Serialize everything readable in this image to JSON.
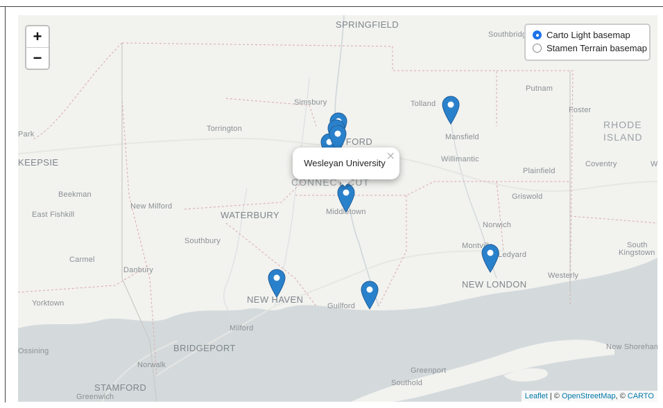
{
  "map": {
    "zoom_in_label": "+",
    "zoom_out_label": "−",
    "layers": [
      {
        "label": "Carto Light basemap",
        "selected": true
      },
      {
        "label": "Stamen Terrain basemap",
        "selected": false
      }
    ],
    "popup": {
      "text": "Wesleyan University",
      "close": "×"
    },
    "markers": [
      "marker-1",
      "marker-2",
      "marker-3",
      "marker-4",
      "marker-5",
      "marker-6",
      "marker-7",
      "marker-8",
      "marker-9"
    ],
    "marker_color": "#2a81cb",
    "water_color": "#d4dadc",
    "land_color": "#f2f2ef",
    "attribution": {
      "leaflet": "Leaflet",
      "separator1": " | © ",
      "osm": "OpenStreetMap",
      "separator2": ", © ",
      "carto": "CARTO"
    },
    "places": {
      "springfield": "SPRINGFIELD",
      "southbridge": "Southbridge",
      "putnam": "Putnam",
      "foster": "Foster",
      "rhode": "RHODE",
      "island": "ISLAND",
      "coventry": "Coventry",
      "w": "W",
      "simsbury": "Simsbury",
      "tolland": "Tolland",
      "mansfield": "Mansfield",
      "torrington": "Torrington",
      "hartford": "HARTFORD",
      "park": "Park",
      "keepsie": "KEEPSIE",
      "willimantic": "Willimantic",
      "plainfield": "Plainfield",
      "connecticut": "CONNECTICUT",
      "beekman": "Beekman",
      "griswold": "Griswold",
      "new_milford": "New Milford",
      "east_fishkill": "East Fishkill",
      "waterbury": "WATERBURY",
      "middletown": "Middletown",
      "norwich": "Norwich",
      "southbury": "Southbury",
      "montville": "Montville",
      "ledyard": "Ledyard",
      "south_kingstown_1": "South",
      "south_kingstown_2": "Kingstown",
      "carmel": "Carmel",
      "danbury": "Danbury",
      "westerly": "Westerly",
      "new_london": "NEW LONDON",
      "yorktown": "Yorktown",
      "new_haven": "NEW HAVEN",
      "guilford": "Guilford",
      "milford": "Milford",
      "bridgeport": "BRIDGEPORT",
      "new_shoreham": "New Shoreham",
      "ossining": "Ossining",
      "norwalk": "Norwalk",
      "greenport": "Greenport",
      "southold": "Southold",
      "stamford": "STAMFORD",
      "greenwich": "Greenwich"
    }
  }
}
